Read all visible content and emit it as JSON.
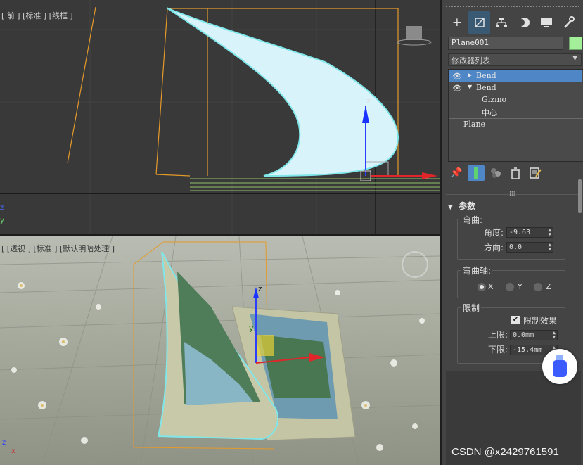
{
  "viewport_front": {
    "label": "[ 前 ] [标准 ] [线框 ]",
    "gizmo_axis_z": "z",
    "corner_axes": [
      "z",
      "y"
    ]
  },
  "viewport_persp": {
    "label": "[ [透视 ] [标准 ] [默认明暗处理 ]",
    "gizmo_axis_z": "z",
    "gizmo_axis_y": "y",
    "corner_axes": [
      "z",
      "x"
    ]
  },
  "panel": {
    "tabs": [
      {
        "name": "create-icon",
        "glyph": "+"
      },
      {
        "name": "modify-icon",
        "glyph": "⬚"
      },
      {
        "name": "hierarchy-icon",
        "glyph": "⊤"
      },
      {
        "name": "motion-icon",
        "glyph": "◐"
      },
      {
        "name": "display-icon",
        "glyph": "▭"
      },
      {
        "name": "utilities-icon",
        "glyph": "🔧"
      }
    ],
    "object_name": "Plane001",
    "object_color": "#a4f09a",
    "modifier_list_label": "修改器列表",
    "stack": [
      {
        "label": "Bend",
        "selected": true,
        "expanded": false
      },
      {
        "label": "Bend",
        "selected": false,
        "expanded": true
      },
      {
        "label": "Gizmo",
        "child": true
      },
      {
        "label": "中心",
        "child": true
      },
      {
        "label": "Plane",
        "base": true
      }
    ],
    "tools": [
      "pin-stack-icon",
      "show-end-result-icon",
      "make-unique-icon",
      "remove-modifier-icon",
      "configure-sets-icon"
    ]
  },
  "params": {
    "rollout_title": "参数",
    "bend_group": "弯曲:",
    "angle_label": "角度:",
    "angle_value": "-9.63",
    "direction_label": "方向:",
    "direction_value": "0.0",
    "axis_group": "弯曲轴:",
    "axes": [
      {
        "label": "X",
        "selected": true
      },
      {
        "label": "Y",
        "selected": false
      },
      {
        "label": "Z",
        "selected": false
      }
    ],
    "limits_group": "限制",
    "limit_effect_label": "限制效果",
    "limit_effect_checked": true,
    "upper_label": "上限:",
    "upper_value": "0.0mm",
    "lower_label": "下限:",
    "lower_value": "-15.4mm"
  },
  "watermark": "CSDN @x2429761591",
  "colors": {
    "accent": "#4f86c6",
    "selection_cyan": "#7fe7ea",
    "gizmo_orange": "#e59a2a"
  }
}
